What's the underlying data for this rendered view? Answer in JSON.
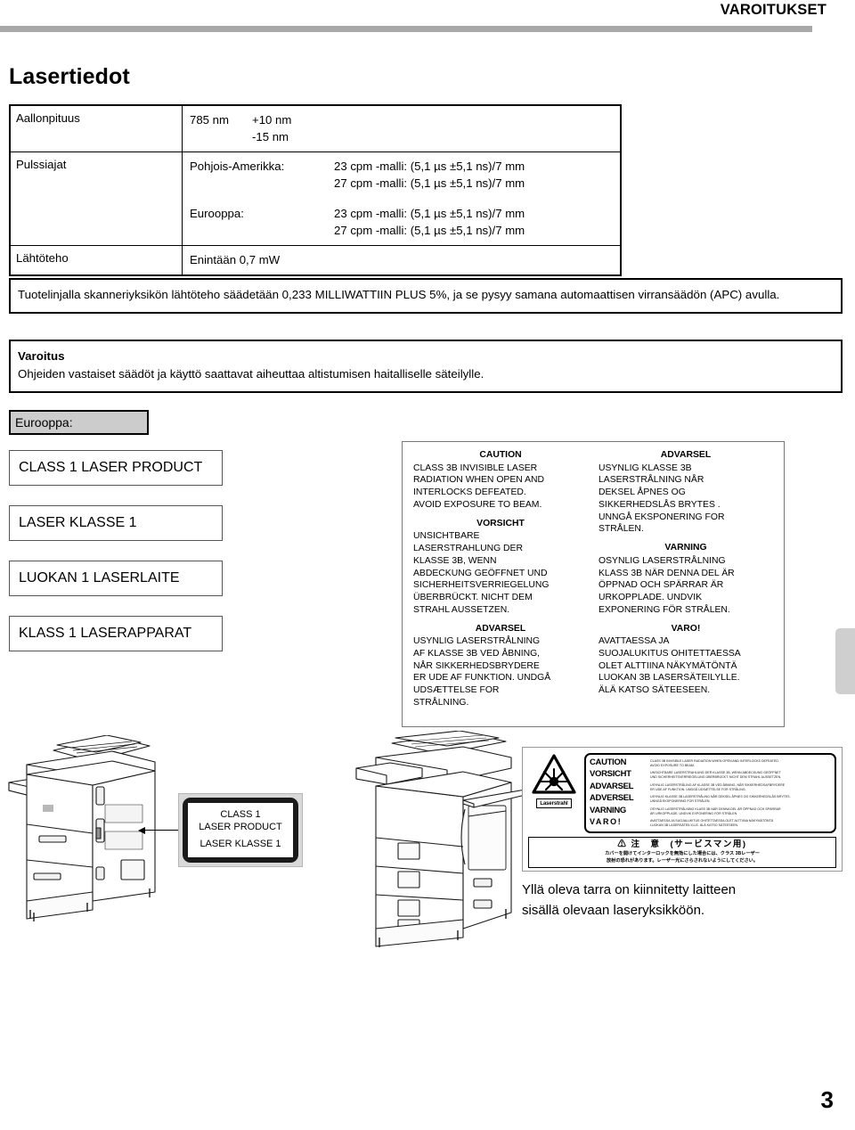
{
  "header": {
    "title": "VAROITUKSET"
  },
  "section": {
    "title": "Lasertiedot"
  },
  "spec_table": {
    "rows": [
      {
        "label": "Aallonpituus",
        "value_a": "785 nm",
        "value_b_line1": "+10 nm",
        "value_b_line2": "-15 nm"
      },
      {
        "label": "Pulssiajat",
        "groups": [
          {
            "region": "Pohjois-Amerikka:",
            "lines": [
              "23 cpm -malli: (5,1 µs ±5,1 ns)/7 mm",
              "27 cpm -malli: (5,1 µs ±5,1 ns)/7 mm"
            ]
          },
          {
            "region": "Eurooppa:",
            "lines": [
              "23 cpm -malli: (5,1 µs ±5,1 ns)/7 mm",
              "27 cpm -malli: (5,1 µs ±5,1 ns)/7 mm"
            ]
          }
        ]
      },
      {
        "label": "Lähtöteho",
        "value_a": "Enintään 0,7 mW"
      }
    ]
  },
  "notes": {
    "apc": "Tuotelinjalla skanneriyksikön lähtöteho säädetään 0,233 MILLIWATTIIN PLUS 5%, ja se pysyy samana automaattisen virransäädön (APC) avulla.",
    "varoitus_title": "Varoitus",
    "varoitus_body": "Ohjeiden vastaiset säädöt ja käyttö saattavat aiheuttaa altistumisen haitalliselle säteilylle."
  },
  "europe": {
    "chip_label": "Eurooppa:",
    "class_boxes": [
      "CLASS 1 LASER PRODUCT",
      "LASER KLASSE 1",
      "LUOKAN 1 LASERLAITE",
      "KLASS 1 LASERAPPARAT"
    ]
  },
  "caution_panel": {
    "left_column": [
      {
        "heading": "CAUTION",
        "body": "CLASS 3B INVISIBLE LASER\nRADIATION WHEN OPEN AND\n INTERLOCKS DEFEATED.\nAVOID EXPOSURE TO BEAM."
      },
      {
        "heading": "VORSICHT",
        "body": "UNSICHTBARE\nLASERSTRAHLUNG  DER\nKLASSE 3B, WENN\nABDECKUNG GEÖFFNET UND\nSICHERHEITSVERRIEGELUNG\nÜBERBRÜCKT. NICHT DEM\nSTRAHL AUSSETZEN."
      },
      {
        "heading": "ADVARSEL",
        "body": "USYNLIG LASERSTRÅLNING\nAF KLASSE 3B VED ÅBNING,\nNÅR SIKKERHEDSBRYDERE\nER UDE AF FUNKTION. UNDGÅ\nUDSÆTTELSE FOR\nSTRÅLNING."
      }
    ],
    "right_column": [
      {
        "heading": "ADVARSEL",
        "body": "USYNLIG KLASSE 3B\nLASERSTRÅLNING NÅR\nDEKSEL ÅPNES OG\nSIKKERHEDSLÅS BRYTES .\nUNNGÅ EKSPONERING FOR\nSTRÅLEN."
      },
      {
        "heading": "VARNING",
        "body": "OSYNLIG LASERSTRÅLNING\nKLASS 3B NÄR DENNA DEL ÄR\nÖPPNAD OCH SPÄRRAR ÄR\nURKOPPLADE. UNDVIK\nEXPONERING FÖR STRÅLEN."
      },
      {
        "heading": "VARO!",
        "body": "AVATTAESSA JA\nSUOJALUKITUS OHITETTAESSA\nOLET ALTTIINA NÄKYMÄTÖNTÄ\nLUOKAN 3B LASERSÄTEILYLLE.\nÄLÄ KATSO SÄTEESEEN."
      }
    ]
  },
  "callout_tag": {
    "line1": "CLASS 1",
    "line2": "LASER PRODUCT",
    "line3": "LASER KLASSE 1"
  },
  "warning_label": {
    "symbol_caption": "Laserstrahl",
    "rows": [
      {
        "word": "CAUTION",
        "desc": "CLASS 3B INVISIBLE LASER RADIATION WHEN OPEN AND INTERLOCKS DEFEATED.\nAVOID EXPOSURE TO BEAM."
      },
      {
        "word": "VORSICHT",
        "desc": "UNSICHTBARE LASERSTRAHLUNG DER KLASSE 3B, WENN ABDECKUNG GEÖFFNET\nUND SICHERHEITSVERRIEGELUNG ÜBERBRÜCKT. NICHT DEM STRAHL AUSSETZEN."
      },
      {
        "word": "ADVARSEL",
        "desc": "USYNLIG LASERSTRÅLING AF KLASSE 3B VED ÅBNING, NÅR SIKKERHEDSAFBRYDERE\nER UDE AF FUNKTION. UNDGÅ UDSÆTTELSE FOR STRÅLING."
      },
      {
        "word": "ADVERSEL",
        "desc": "USYNLIG KLASSE 3B LASERSTRÅLING NÅR DEKSEL ÅPNES OG SIKKERHEDSLÅS BRYTES.\nUNNGÅ EKSPONERING FOR STRÅLEN."
      },
      {
        "word": "VARNING",
        "desc": "OSYNLIG LASERSTRÅLNING KLASS 3B NÄR DENNA DEL ÄR ÖPPNAD OCH SPÄRRAR\nÄR URKOPPLADE.  UNDVIK EXPONERING FÖR STRÅLEN."
      },
      {
        "word": "VARO!",
        "desc": "AVATTAESSA  JA  SUOJALUKITUS  OHITETTAESSA  OLET  ALTTIINA  NÄKYMÄTÖNTÄ\nLUOKAN 3B LASERSÄTEILYLLE. ÄLÄ KATSO SÄTEESEEN."
      }
    ],
    "jp_title": "注　意　(サービスマン用)",
    "jp_body": "カバーを開けてインターロックを無効にした場合には、クラス 3Bレーザー\n放射の恐れがあります。レーザー光にさらされないようにしてください。"
  },
  "caption": "Yllä oleva tarra on kiinnitetty laitteen\nsisällä olevaan laseryksikköön.",
  "page_number": "3",
  "colors": {
    "header_rule": "#a8a8a8",
    "chip_fill": "#cccccc",
    "edge_tab": "#cfcfcf",
    "callout_bg": "#d9d9d9"
  }
}
